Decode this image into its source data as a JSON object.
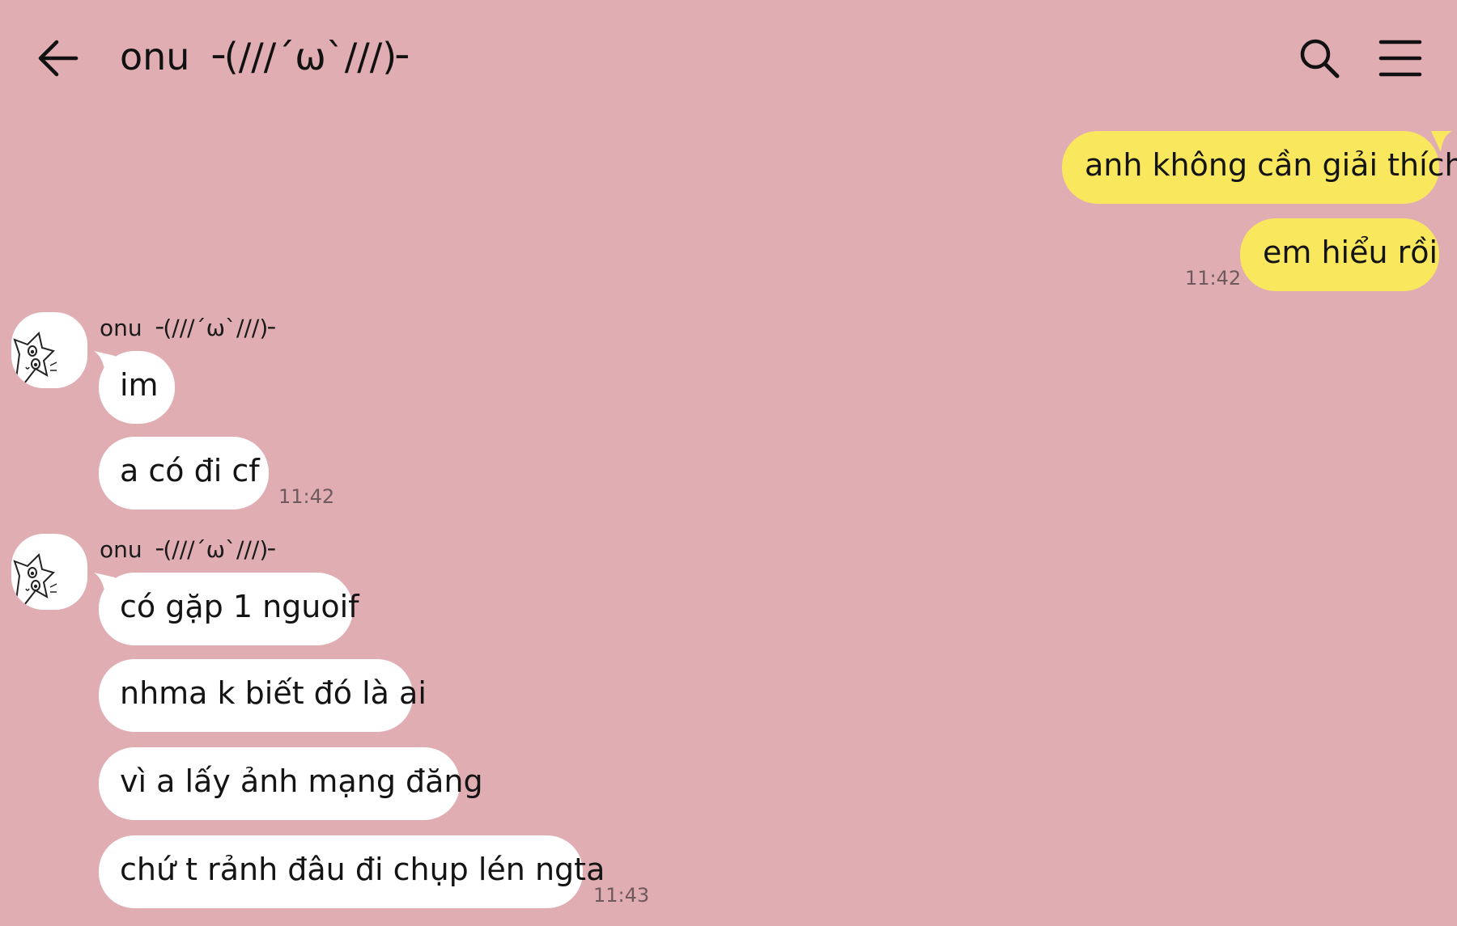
{
  "header": {
    "title": "onu ╶(∕∕∕´ω`∕∕∕)╴",
    "back_icon": "arrow-left-icon",
    "search_icon": "search-icon",
    "menu_icon": "hamburger-menu-icon"
  },
  "colors": {
    "background": "#e0adb2",
    "outgoing_bubble": "#f9e75e",
    "incoming_bubble": "#ffffff"
  },
  "messages": {
    "out1": {
      "text": "anh không cần giải thích"
    },
    "out2": {
      "text": "em hiểu rồi",
      "time": "11:42"
    },
    "group1": {
      "sender": "onu ╶(∕∕∕´ω`∕∕∕)╴",
      "m1": "im",
      "m2": "a có đi cf",
      "time": "11:42"
    },
    "group2": {
      "sender": "onu ╶(∕∕∕´ω`∕∕∕)╴",
      "m1": "có gặp 1 nguoif",
      "m2": "nhma k biết đó là ai",
      "m3": "vì a lấy ảnh mạng đăng",
      "m4": "chứ t rảnh đâu đi chụp lén ngta",
      "time": "11:43"
    }
  }
}
